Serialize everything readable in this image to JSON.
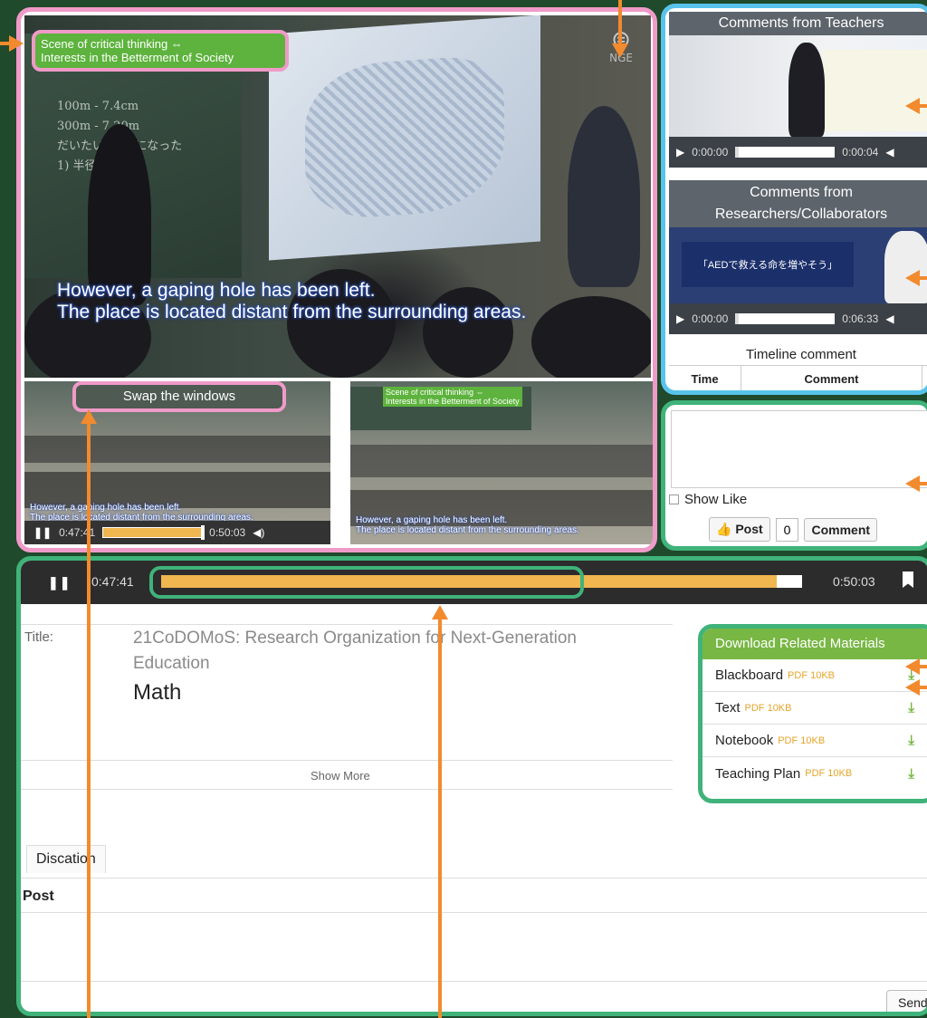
{
  "colors": {
    "background": "#1f4a2b",
    "pink_outline": "#f09ac8",
    "blue_outline": "#58c3ea",
    "green_outline": "#3fb37a",
    "arrow": "#f28a2e",
    "progress": "#f0b650",
    "download_header": "#78b744"
  },
  "main_video": {
    "scene_tag": "Scene of critical thinking ⇔\nInterests in the Betterment of Society",
    "logo_text": "NGE",
    "subtitle": "However, a gaping hole has been left.\nThe place is located distant from the surrounding areas.",
    "board_text": "100m - 7.4cm\n300m - 7.20m\nだいたい  以内になった\n1) 半径 \n  "
  },
  "sub_video_left": {
    "swap_label": "Swap the windows",
    "subtitle": "However, a gaping hole has been left.\nThe place is located distant from the surrounding areas.",
    "time_current": "0:47:41",
    "time_total": "0:50:03",
    "progress": 0.95
  },
  "sub_video_right": {
    "tag": "Scene of critical thinking ⇔\nInterests in the Betterment of Society",
    "subtitle": "However, a gaping hole has been left.\nThe place is located distant from the surrounding areas."
  },
  "teacher_comments": {
    "title": "Comments from Teachers",
    "time_current": "0:00:00",
    "time_total": "0:00:04"
  },
  "researcher_comments": {
    "title_line1": "Comments from",
    "title_line2": "Researchers/Collaborators",
    "slide_text": "「AEDで救える命を増やそう」",
    "time_current": "0:00:00",
    "time_total": "0:06:33"
  },
  "timeline": {
    "title": "Timeline comment",
    "col_time": "Time",
    "col_comment": "Comment"
  },
  "comment_box": {
    "show_like": "Show Like",
    "post_label": "Post",
    "like_count": "0",
    "comment_label": "Comment"
  },
  "player": {
    "time_current": "0:47:41",
    "time_total": "0:50:03",
    "progress": 0.95
  },
  "details": {
    "title_label": "Title:",
    "title": "21CoDOMoS: Research Organization for Next-Generation Education",
    "subject": "Math",
    "show_more": "Show More"
  },
  "downloads": {
    "header": "Download Related Materials",
    "items": [
      {
        "name": "Blackboard",
        "meta": "PDF 10KB"
      },
      {
        "name": "Text",
        "meta": "PDF 10KB"
      },
      {
        "name": "Notebook",
        "meta": "PDF 10KB"
      },
      {
        "name": "Teaching Plan",
        "meta": "PDF 10KB"
      }
    ]
  },
  "discussion": {
    "tab_label": "Discation",
    "post_label": "Post",
    "send_label": "Send"
  }
}
